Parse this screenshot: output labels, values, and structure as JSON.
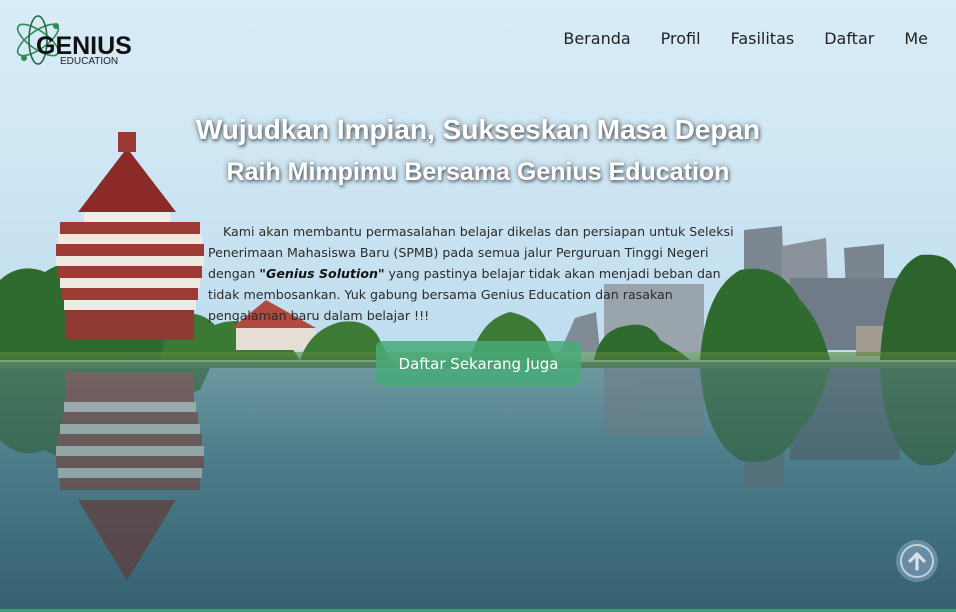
{
  "brand": {
    "name": "GENIUS",
    "tagline": "EDUCATION",
    "logo_icon": "atom-icon"
  },
  "nav": {
    "items": [
      "Beranda",
      "Profil",
      "Fasilitas",
      "Daftar",
      "Me"
    ]
  },
  "hero": {
    "title_line1": "Wujudkan Impian, Sukseskan Masa Depan",
    "title_line2": "Raih Mimpimu Bersama Genius Education",
    "desc_part1": "Kami akan membantu permasalahan belajar dikelas dan persiapan untuk Seleksi Penerimaan Mahasiswa Baru (SPMB) pada semua jalur Perguruan Tinggi Negeri dengan ",
    "desc_highlight": "\"Genius Solution\"",
    "desc_part2": " yang pastinya belajar tidak akan menjadi beban dan tidak membosankan. Yuk gabung bersama Genius Education dan rasakan pengalaman baru dalam belajar !!!",
    "cta_label": "Daftar Sekarang Juga"
  },
  "scroll_top": {
    "icon": "arrow-up-circle-icon"
  },
  "colors": {
    "accent": "#48aa78",
    "title_text": "#ffffff"
  }
}
